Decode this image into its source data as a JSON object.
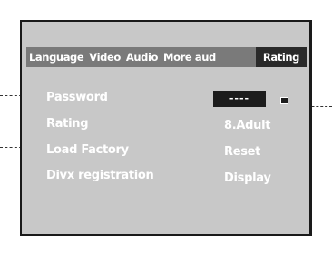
{
  "tabs": [
    "Language",
    "Video",
    "Audio",
    "More aud",
    "Rating"
  ],
  "active_tab": "Rating",
  "rows": [
    {
      "label": "Password",
      "value": "----"
    },
    {
      "label": "Rating",
      "value": "8.Adult"
    },
    {
      "label": "Load Factory",
      "value": "Reset"
    },
    {
      "label": "Divx registration",
      "value": "Display"
    }
  ],
  "icons": {
    "lock": "lock-icon"
  },
  "colors": {
    "panel": "#c8c8c8",
    "tab_bar": "#7a7a7a",
    "active_tab": "#2a2a2a",
    "password_field": "#1c1c1c",
    "text": "#ffffff"
  }
}
